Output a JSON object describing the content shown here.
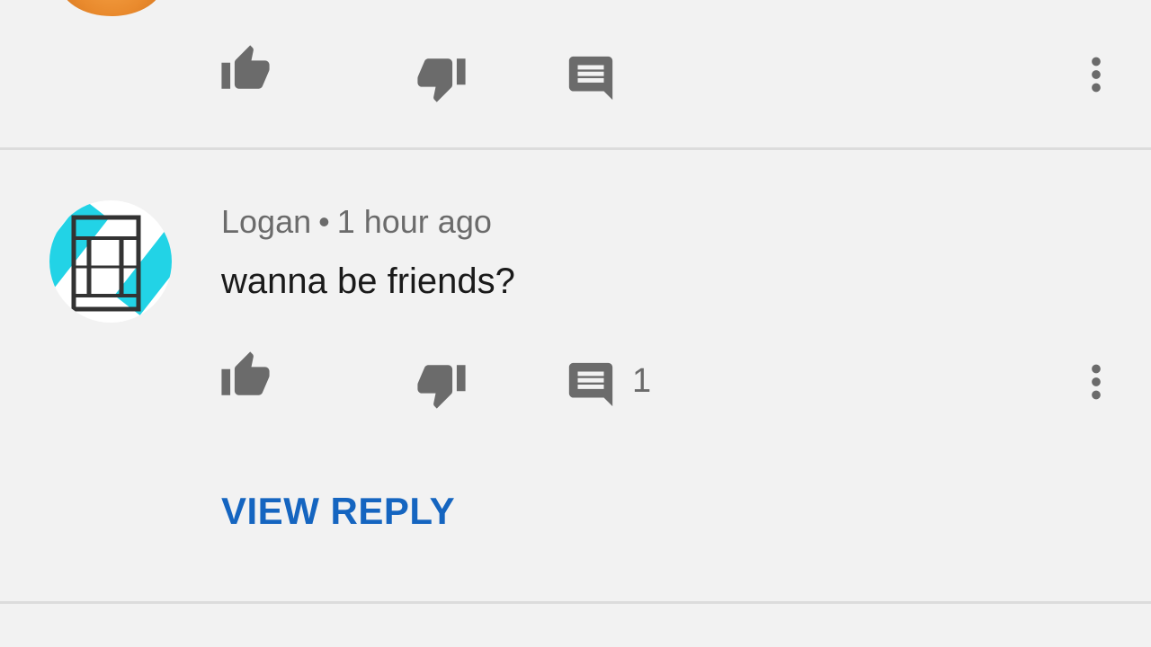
{
  "colors": {
    "background": "#f2f2f2",
    "icon": "#6b6b6b",
    "link": "#1565c0",
    "divider": "#dcdcdc"
  },
  "previous_comment": {
    "actions": {
      "like_icon": "thumb-up-icon",
      "dislike_icon": "thumb-down-icon",
      "reply_icon": "comment-icon",
      "more_icon": "more-vert-icon"
    }
  },
  "comment": {
    "author": "Logan",
    "separator": "•",
    "time": "1 hour ago",
    "text": "wanna be friends?",
    "reply_count": "1",
    "view_reply_label": "VIEW REPLY",
    "actions": {
      "like_icon": "thumb-up-icon",
      "dislike_icon": "thumb-down-icon",
      "reply_icon": "comment-icon",
      "more_icon": "more-vert-icon"
    }
  }
}
